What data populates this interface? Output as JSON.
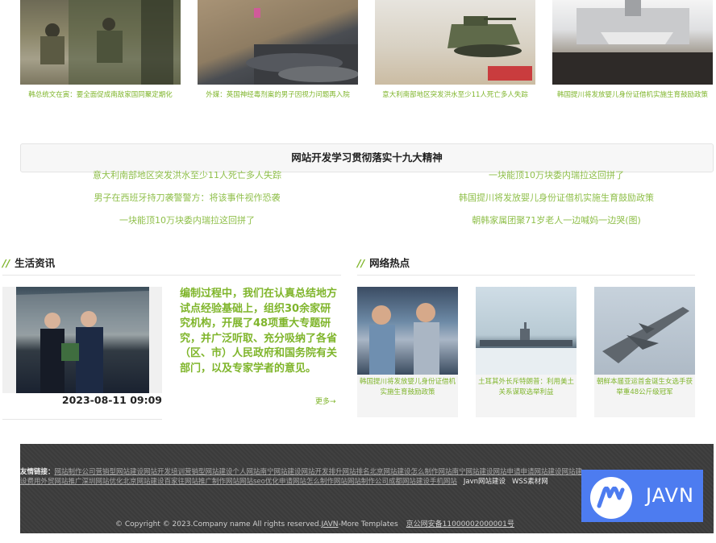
{
  "top_cards": [
    {
      "caption": "韩总统文在寅：要全面促成南敌家国同聚定期化"
    },
    {
      "caption": "外媒：英国神经毒剂案的男子因视力问题再入院"
    },
    {
      "caption": "意大利南部地区突发洪水至少11人死亡多人失踪"
    },
    {
      "caption": "韩国提川将发放婴儿身份证借机实施生育鼓励政策"
    }
  ],
  "banner": {
    "title": "网站开发学习贯彻落实十九大精神"
  },
  "news_left": [
    "意大利南部地区突发洪水至少11人死亡多人失踪",
    "男子在西班牙持刀袭警警方：将该事件视作恐袭",
    "一块能顶10万块委内瑞拉这回拼了"
  ],
  "news_right": [
    "一块能顶10万块委内瑞拉这回拼了",
    "韩国提川将发放婴儿身份证借机实施生育鼓励政策",
    "朝韩家属团聚71岁老人一边喊妈一边哭(图)"
  ],
  "life": {
    "heading": "生活资讯",
    "date": "2023-08-11 09:09",
    "text": "编制过程中，我们在认真总结地方试点经验基础上，组织30余家研究机构，开展了48项重大专题研究，并广泛听取、充分吸纳了各省（区、市）人民政府和国务院有关部门，以及专家学者的意见。",
    "more": "更多→"
  },
  "hot": {
    "heading": "网络热点",
    "items": [
      {
        "caption": "韩国提川将发放婴儿身份证借机实施生育鼓励政策"
      },
      {
        "caption": "土耳其外长斥特朗普：利用美土关系谋取选举利益"
      },
      {
        "caption": "朝鲜本届亚运首金诞生女选手获举重48公斤级冠军"
      }
    ]
  },
  "footer": {
    "friend_label": "友情链接：",
    "friend_links": "网站制作公司营销型网站建设网站开发培训营销型网站建设个人网站南宁网站建设网站开发排升网站排名北京网站建设怎么制作网站南宁网站建设网站申请申请网站建设网站建设费用外贸网站推广深圳网站优化北京网站建设百家往网站推广制作网站网站seo优化申请网站怎么制作网站网站制作公司成都网站建设手机网站",
    "extra_links": [
      "Javn网站建设",
      "WSS素材网"
    ],
    "copyright": "© Copyright © 2023.Company name All rights reserved.",
    "jav": "JAVN",
    "templates": "-More Templates",
    "icp": "京公网安备11000002000001号"
  },
  "logo": {
    "text": "JAVN"
  },
  "colors": {
    "accent": "#7fb52b",
    "footer_bg": "#3b3b3b",
    "logo_bg": "#4d7cf0"
  }
}
